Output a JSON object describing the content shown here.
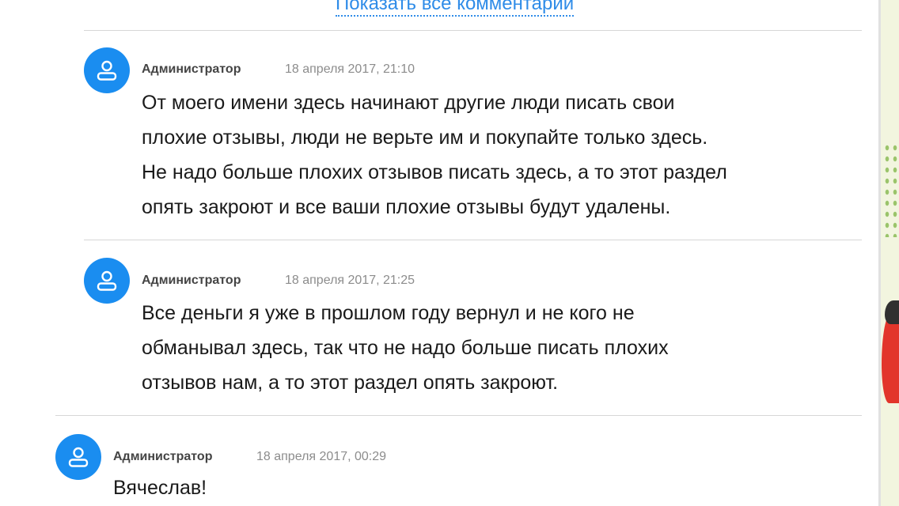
{
  "show_all_comments": "Показать все комментарии",
  "colors": {
    "accent": "#1a8df0",
    "link": "#2f8ce8",
    "author": "#444444",
    "date": "#8c8c8c",
    "text": "#1a1a1a",
    "divider": "#d7d7d7"
  },
  "comments": [
    {
      "avatar_icon": "user-icon",
      "author": "Администратор",
      "date": "18 апреля 2017, 21:10",
      "lines": [
        "От моего имени здесь начинают другие люди писать свои",
        "плохие отзывы, люди не верьте им и покупайте только здесь.",
        "Не надо больше плохих отзывов писать здесь, а то этот раздел",
        "опять закроют и все ваши плохие отзывы будут удалены."
      ]
    },
    {
      "avatar_icon": "user-icon",
      "author": "Администратор",
      "date": "18 апреля 2017, 21:25",
      "lines": [
        "Все деньги я уже в прошлом году вернул и не кого не",
        "обманывал здесь, так что не надо больше писать плохих",
        "отзывов нам, а то этот раздел опять закроют."
      ]
    },
    {
      "avatar_icon": "user-icon",
      "author": "Администратор",
      "date": "18 апреля 2017, 00:29",
      "lines": [
        "Вячеслав!"
      ]
    }
  ]
}
